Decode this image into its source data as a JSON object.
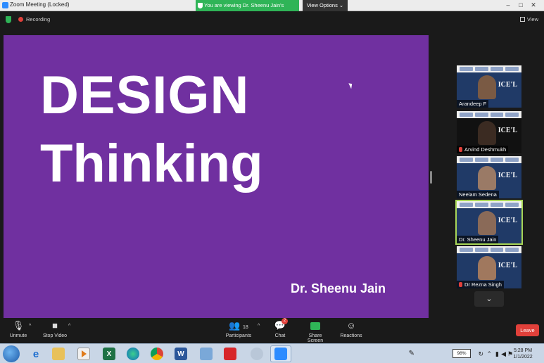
{
  "window": {
    "title": "Zoom Meeting (Locked)",
    "viewing_banner": "You are viewing Dr. Sheenu Jain's screen",
    "view_options": "View Options ⌄",
    "controls": [
      "–",
      "□",
      "✕"
    ]
  },
  "status": {
    "recording_label": "Recording",
    "view_label": "View"
  },
  "slide": {
    "title_line1": "DESIGN",
    "title_line2": "Thinking",
    "author": "Dr. Sheenu Jain",
    "background": "#7030a0"
  },
  "participants": [
    {
      "name": "Arandeep F",
      "muted": false,
      "active": false
    },
    {
      "name": "Arvind Deshmukh",
      "muted": true,
      "active": false
    },
    {
      "name": "Neelam Sedena",
      "muted": false,
      "active": false
    },
    {
      "name": "Dr. Sheenu Jain",
      "muted": false,
      "active": true
    },
    {
      "name": "Dr Rezna Singh",
      "muted": true,
      "active": false
    }
  ],
  "tile_label": "ICE'L",
  "toolbar": {
    "unmute": "Unmute",
    "stop_video": "Stop Video",
    "participants": "Participants",
    "participants_count": "18",
    "chat": "Chat",
    "chat_badge": "2",
    "share_screen": "Share Screen",
    "reactions": "Reactions",
    "leave": "Leave"
  },
  "taskbar": {
    "apps": [
      "e",
      "",
      "",
      "X",
      "",
      "",
      "W",
      "",
      "",
      "",
      ""
    ],
    "battery_label": "98%",
    "time": "5:28 PM",
    "date": "1/1/2022"
  },
  "colors": {
    "accent_green": "#2fb457",
    "leave_red": "#e0403a",
    "active_tile": "#a8d657"
  }
}
